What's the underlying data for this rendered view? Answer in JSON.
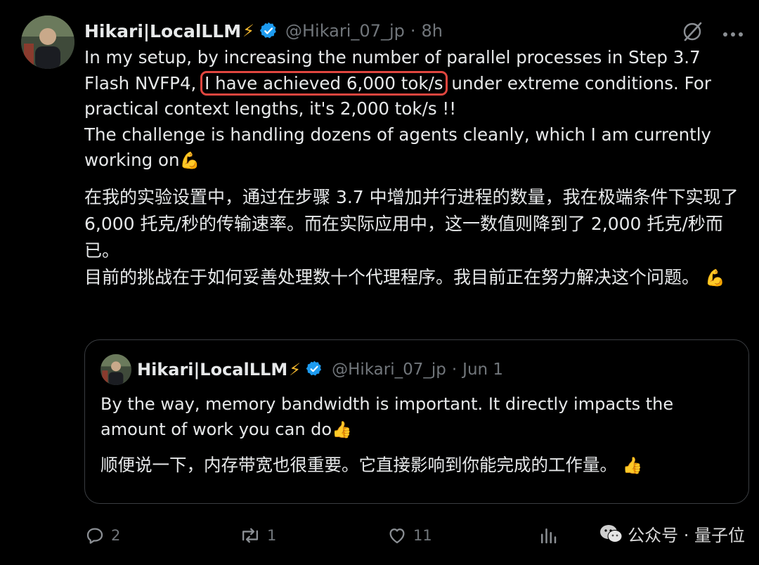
{
  "tweet": {
    "author_name": "Hikari|LocalLLM",
    "handle": "@Hikari_07_jp",
    "separator": "·",
    "time": "8h",
    "text_en_part1": "In my setup, by increasing the number of parallel processes in Step 3.7 Flash NVFP4, ",
    "text_en_highlight": "I have achieved 6,000 tok/s",
    "text_en_part2": " under extreme conditions. For practical context lengths, it's 2,000 tok/s !!",
    "text_en_line2": "The challenge is handling dozens of agents cleanly, which I am currently working on",
    "muscle_emoji": "💪",
    "text_zh_1": "在我的实验设置中，通过在步骤 3.7 中增加并行进程的数量，我在极端条件下实现了 6,000 托克/秒的传输速率。而在实际应用中，这一数值则降到了 2,000 托克/秒而已。",
    "text_zh_2": "目前的挑战在于如何妥善处理数十个代理程序。我目前正在努力解决这个问题。",
    "muscle_emoji_2": "💪"
  },
  "quoted": {
    "author_name": "Hikari|LocalLLM",
    "handle": "@Hikari_07_jp",
    "separator": "·",
    "time": "Jun 1",
    "text_en": "By the way, memory bandwidth is important. It directly impacts the amount of work you can do",
    "thumbs_emoji": "👍",
    "text_zh": "顺便说一下，内存带宽也很重要。它直接影响到你能完成的工作量。",
    "thumbs_emoji_2": "👍"
  },
  "bolt_emoji": "⚡",
  "actions": {
    "reply_count": "2",
    "retweet_count": "1",
    "like_count": "11"
  },
  "watermark": {
    "text": "公众号 · 量子位"
  },
  "colors": {
    "background": "#000000",
    "text": "#e7e9ea",
    "muted": "#71767b",
    "verified": "#1d9bf0",
    "highlight_box": "#e0463f",
    "bolt": "#f5b82e"
  },
  "icons": [
    "verified-badge-icon",
    "grok-icon",
    "more-icon",
    "reply-icon",
    "retweet-icon",
    "like-icon",
    "views-icon",
    "wechat-icon"
  ]
}
